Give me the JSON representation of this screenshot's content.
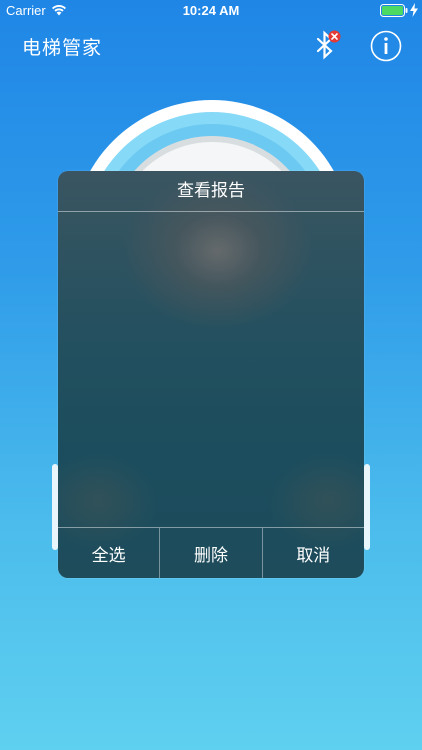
{
  "status_bar": {
    "carrier": "Carrier",
    "time": "10:24 AM",
    "wifi_icon": "wifi-icon",
    "battery_icon": "battery-icon",
    "battery_color": "#4cd964"
  },
  "nav": {
    "title": "电梯管家",
    "bluetooth_icon": "bluetooth-disconnected-icon",
    "info_icon": "info-icon"
  },
  "dialog": {
    "title": "查看报告",
    "buttons": {
      "select_all": "全选",
      "delete": "删除",
      "cancel": "取消"
    }
  },
  "colors": {
    "background_top": "#1f86e6",
    "background_bottom": "#5fd0ef",
    "gauge_ring": "#7dd6f6",
    "dialog_bg": "#1e4c5b",
    "bluetooth_badge": "#e53935"
  }
}
